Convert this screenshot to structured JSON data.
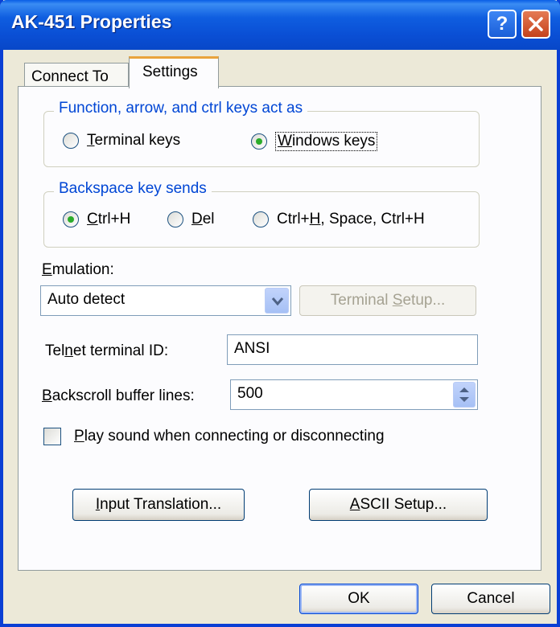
{
  "window": {
    "title": "AK-451 Properties"
  },
  "tabs": [
    {
      "label": "Connect To"
    },
    {
      "label": "Settings"
    }
  ],
  "function_keys": {
    "legend": "Function, arrow, and ctrl keys act as",
    "opt1": {
      "mn": "T",
      "rest": "erminal keys",
      "checked": false
    },
    "opt2": {
      "mn": "W",
      "rest": "indows keys",
      "checked": true
    }
  },
  "backspace": {
    "legend": "Backspace key sends",
    "opt1": {
      "mn": "C",
      "rest": "trl+H",
      "checked": true
    },
    "opt2": {
      "mn": "D",
      "rest": "el",
      "checked": false
    },
    "opt3": {
      "pre": "Ctrl+",
      "mn": "H",
      "rest": ", Space, Ctrl+H",
      "checked": false
    }
  },
  "emulation": {
    "label_mn": "E",
    "label_rest": "mulation:",
    "value": "Auto detect",
    "setup_pre": "Terminal ",
    "setup_mn": "S",
    "setup_rest": "etup..."
  },
  "telnet": {
    "label_pre": "Tel",
    "label_mn": "n",
    "label_rest": "et terminal ID:",
    "value": "ANSI"
  },
  "backscroll": {
    "label_mn": "B",
    "label_rest": "ackscroll buffer lines:",
    "value": "500"
  },
  "play_sound": {
    "mn": "P",
    "rest": "lay sound when connecting or disconnecting",
    "checked": false
  },
  "buttons": {
    "input_mn": "I",
    "input_rest": "nput Translation...",
    "ascii_mn": "A",
    "ascii_rest": "SCII Setup...",
    "ok": "OK",
    "cancel": "Cancel"
  }
}
